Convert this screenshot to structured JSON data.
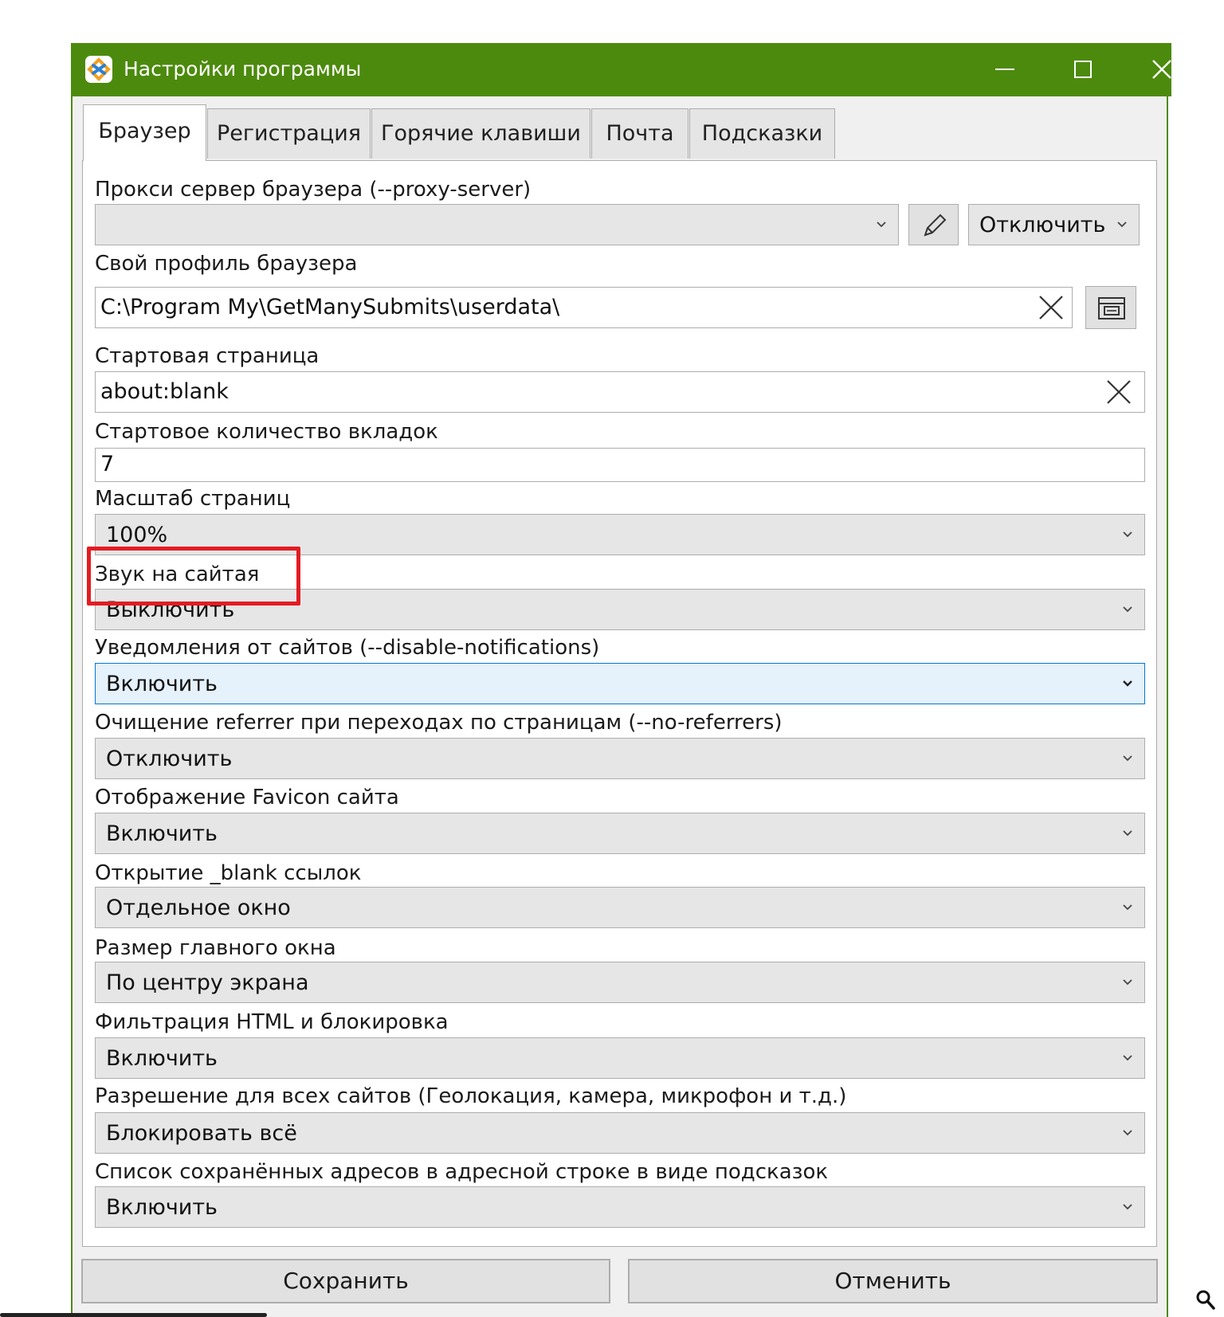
{
  "window": {
    "title": "Настройки программы"
  },
  "tabs": [
    {
      "label": "Браузер"
    },
    {
      "label": "Регистрация"
    },
    {
      "label": "Горячие клавиши"
    },
    {
      "label": "Почта"
    },
    {
      "label": "Подсказки"
    }
  ],
  "fields": {
    "proxy": {
      "label": "Прокси сервер браузера (--proxy-server)",
      "value": "",
      "mode": "Отключить"
    },
    "profile": {
      "label": "Свой профиль браузера",
      "value": "C:\\Program My\\GetManySubmits\\userdata\\"
    },
    "start_page": {
      "label": "Стартовая страница",
      "value": "about:blank"
    },
    "start_tabs": {
      "label": "Стартовое количество вкладок",
      "value": "7"
    },
    "zoom": {
      "label": "Масштаб страниц",
      "value": "100%"
    },
    "sound": {
      "label": "Звук на сайтая",
      "value": "Выключить"
    },
    "notifications": {
      "label": "Уведомления от сайтов (--disable-notifications)",
      "value": "Включить"
    },
    "referrer": {
      "label": "Очищение referrer при переходах по страницам (--no-referrers)",
      "value": "Отключить"
    },
    "favicon": {
      "label": "Отображение Favicon сайта",
      "value": "Включить"
    },
    "blank_links": {
      "label": "Открытие _blank ссылок",
      "value": "Отдельное окно"
    },
    "window_size": {
      "label": "Размер главного окна",
      "value": "По центру экрана"
    },
    "html_filter": {
      "label": "Фильтрация HTML и блокировка",
      "value": "Включить"
    },
    "permissions": {
      "label": "Разрешение для всех сайтов (Геолокация, камера, микрофон и т.д.)",
      "value": "Блокировать всё"
    },
    "address_hints": {
      "label": "Список сохранённых адресов в адресной строке в виде подсказок",
      "value": "Включить"
    }
  },
  "buttons": {
    "save": "Сохранить",
    "cancel": "Отменить"
  },
  "colors": {
    "titlebar": "#4c8a0d",
    "highlight": "#e31c23",
    "focus": "#0078d7"
  }
}
